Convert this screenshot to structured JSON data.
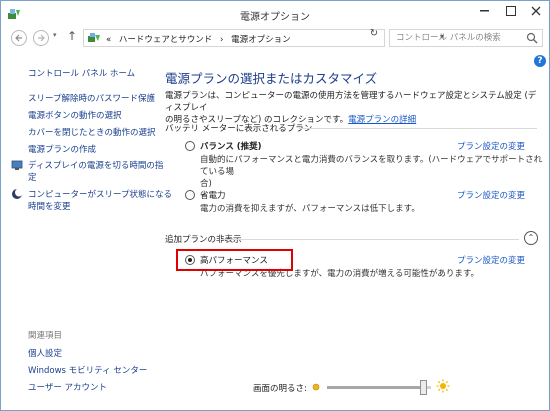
{
  "window": {
    "title": "電源オプション"
  },
  "address": {
    "recent_symbol": "▾",
    "up_symbol": "↑",
    "prefix": "«",
    "crumbs": [
      "ハードウェアとサウンド",
      "›",
      "電源オプション"
    ],
    "dropdown_symbol": "▾",
    "refresh_symbol": "↻"
  },
  "search": {
    "placeholder": "コントロール パネルの検索"
  },
  "sidebar": {
    "home": "コントロール パネル ホーム",
    "links": [
      "スリープ解除時のパスワード保護",
      "電源ボタンの動作の選択",
      "カバーを閉じたときの動作の選択",
      "電源プランの作成",
      "ディスプレイの電源を切る時間の指定",
      "コンピューターがスリープ状態になる時間を変更"
    ],
    "display_link_lines": [
      "ディスプレイの電源を切る時間の指",
      "定"
    ],
    "sleep_link_lines": [
      "コンピューターがスリープ状態になる",
      "時間を変更"
    ],
    "see_also": "関連項目",
    "see_also_links": [
      "個人設定",
      "Windows モビリティ センター",
      "ユーザー アカウント"
    ]
  },
  "main": {
    "help_symbol": "?",
    "heading": "電源プランの選択またはカスタマイズ",
    "intro_line1": "電源プランは、コンピューターの電源の使用方法を管理するハードウェア設定とシステム設定 (ディスプレイ",
    "intro_line2": "の明るさやスリープなど) のコレクションです。",
    "intro_link": "電源プランの詳細",
    "battery_section": "バッテリ メーターに表示されるプラン",
    "additional_section": "追加プランの非表示",
    "collapse_symbol": "⌃",
    "plans": [
      {
        "name": "バランス (推奨)",
        "desc_lines": [
          "自動的にパフォーマンスと電力消費のバランスを取ります。(ハードウェアでサポートされている場",
          "合)"
        ],
        "link": "プラン設定の変更",
        "selected": false
      },
      {
        "name": "省電力",
        "desc_lines": [
          "電力の消費を抑えますが、パフォーマンスは低下します。"
        ],
        "link": "プラン設定の変更",
        "selected": false
      },
      {
        "name": "高パフォーマンス",
        "desc_lines": [
          "パフォーマンスを優先しますが、電力の消費が増える可能性があります。"
        ],
        "link": "プラン設定の変更",
        "selected": true
      }
    ]
  },
  "brightness": {
    "label": "画面の明るさ:",
    "level": 0.93
  },
  "colors": {
    "accent_link": "#1a57c4",
    "heading": "#1b3b8b",
    "highlight": "#e00000"
  }
}
